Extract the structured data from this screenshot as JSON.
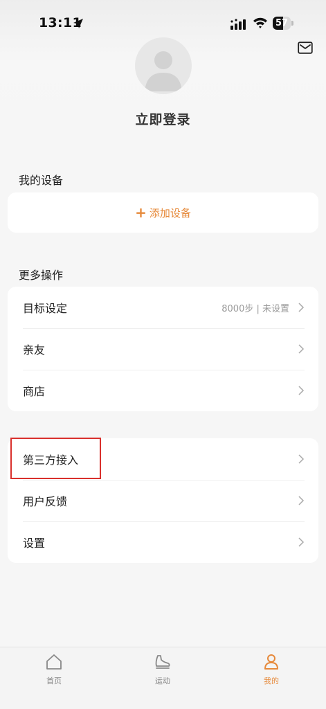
{
  "status_bar": {
    "time": "13:11",
    "battery_level": "57",
    "battery_fraction": 0.57
  },
  "profile": {
    "login_label": "立即登录"
  },
  "devices": {
    "section_title": "我的设备",
    "add_label": "添加设备"
  },
  "more": {
    "section_title": "更多操作",
    "items": [
      {
        "label": "目标设定",
        "value": "8000步 | 未设置"
      },
      {
        "label": "亲友"
      },
      {
        "label": "商店"
      }
    ]
  },
  "other": {
    "items": [
      {
        "label": "第三方接入"
      },
      {
        "label": "用户反馈"
      },
      {
        "label": "设置"
      }
    ]
  },
  "tabbar": {
    "tabs": [
      {
        "label": "首页",
        "icon": "home-icon"
      },
      {
        "label": "运动",
        "icon": "shoe-icon"
      },
      {
        "label": "我的",
        "icon": "profile-icon",
        "active": true
      }
    ]
  },
  "colors": {
    "accent": "#e6893a",
    "highlight": "#d9302c"
  }
}
